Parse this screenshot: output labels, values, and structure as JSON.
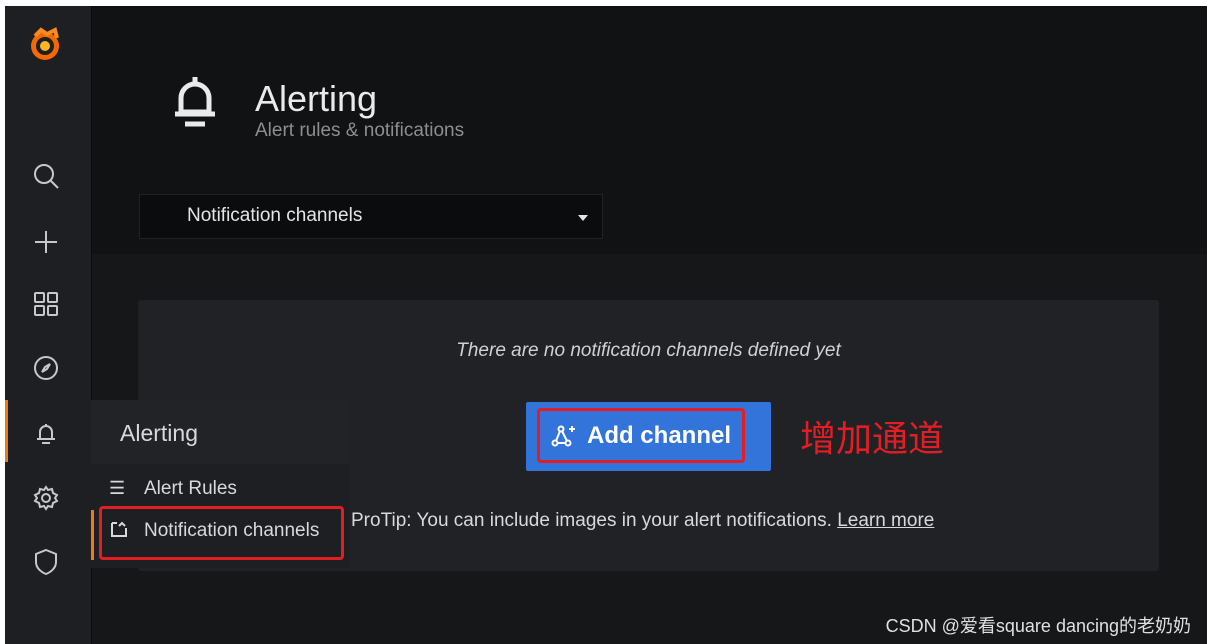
{
  "header": {
    "title": "Alerting",
    "subtitle": "Alert rules & notifications"
  },
  "select": {
    "value": "Notification channels"
  },
  "empty_state": {
    "message": "There are no notification channels defined yet",
    "add_button_label": "Add channel",
    "protip_text": "ProTip: You can include images in your alert notifications. ",
    "learn_more": "Learn more"
  },
  "annotation": "增加通道",
  "submenu": {
    "title": "Alerting",
    "items": [
      {
        "label": "Alert Rules",
        "icon": "list-icon"
      },
      {
        "label": "Notification channels",
        "icon": "comment-alt-share-icon"
      }
    ]
  },
  "sidebar": {
    "icons": [
      "grafana-logo",
      "search-icon",
      "plus-icon",
      "dashboards-icon",
      "explore-icon",
      "bell-icon",
      "gear-icon",
      "shield-icon"
    ]
  },
  "watermark": "CSDN @爱看square dancing的老奶奶",
  "colors": {
    "accent": "#eb7b18",
    "primary_button": "#3274d9",
    "annotation_red": "#e31d24"
  }
}
